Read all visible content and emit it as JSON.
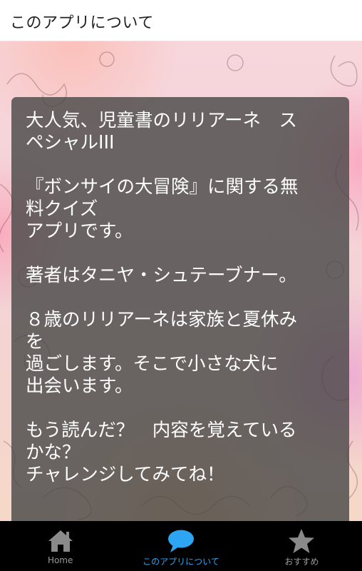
{
  "header": {
    "title": "このアプリについて"
  },
  "about": {
    "text": "大人気、児童書のリリアーネ　ス\nペシャルIII\n\n『ボンサイの大冒険』に関する無\n料クイズ\nアプリです。\n\n著者はタニヤ・シュテーブナー。\n\n８歳のリリアーネは家族と夏休み\nを\n過ごします。そこで小さな犬に\n出会います。\n\nもう読んだ？　内容を覚えている\nかな？\nチャレンジしてみてね！"
  },
  "bottom_nav": {
    "tabs": [
      {
        "label": "Home",
        "icon": "home-icon",
        "active": false
      },
      {
        "label": "このアプリについて",
        "icon": "chat-bubble-icon",
        "active": true
      },
      {
        "label": "おすすめ",
        "icon": "star-icon",
        "active": false
      }
    ]
  },
  "colors": {
    "accent": "#2da5f2",
    "inactive": "#9a9a9a",
    "nav_bg": "#000000",
    "card_bg": "#464646"
  }
}
